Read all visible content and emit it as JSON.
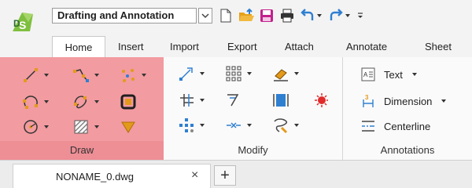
{
  "quick_access": {
    "workspace_value": "Drafting and Annotation",
    "buttons": [
      "new-icon",
      "open-icon",
      "save-icon",
      "print-icon",
      "undo-icon",
      "redo-icon",
      "customize-icon"
    ]
  },
  "tabs": [
    "Home",
    "Insert",
    "Import",
    "Export",
    "Attach",
    "Annotate",
    "Sheet"
  ],
  "active_tab": "Home",
  "ribbon": {
    "draw": {
      "label": "Draw"
    },
    "modify": {
      "label": "Modify"
    },
    "annotations": {
      "label": "Annotations",
      "items": [
        {
          "label": "Text",
          "icon": "text-icon"
        },
        {
          "label": "Dimension",
          "icon": "dimension-icon"
        },
        {
          "label": "Centerline",
          "icon": "centerline-icon"
        }
      ]
    }
  },
  "document_tabs": [
    {
      "name": "NONAME_0.dwg"
    }
  ],
  "add_tab_symbol": "+",
  "close_symbol": "×",
  "colors": {
    "draw_group_bg": "#f29ba0",
    "accent_blue": "#2f7fd1",
    "accent_orange": "#e39a1b",
    "accent_magenta": "#c2218c"
  }
}
